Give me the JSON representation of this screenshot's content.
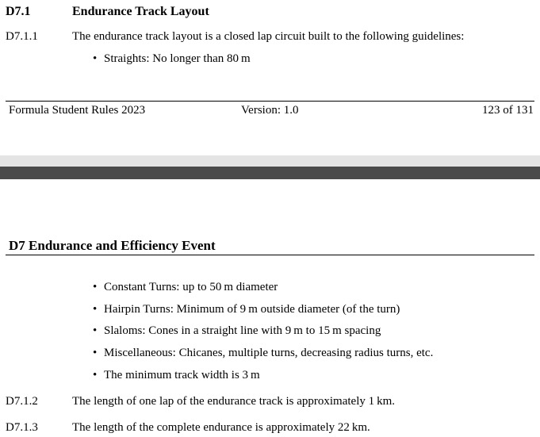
{
  "page1": {
    "section_number": "D7.1",
    "section_title": "Endurance Track Layout",
    "rule_number": "D7.1.1",
    "rule_text": "The endurance track layout is a closed lap circuit built to the following guidelines:",
    "bullets": [
      "Straights: No longer than 80 m"
    ],
    "footer": {
      "left": "Formula Student Rules 2023",
      "center": "Version: 1.0",
      "right": "123 of 131"
    }
  },
  "page2": {
    "header": "D7  Endurance and Efficiency Event",
    "bullets": [
      "Constant Turns: up to 50 m diameter",
      "Hairpin Turns: Minimum of 9 m outside diameter (of the turn)",
      "Slaloms: Cones in a straight line with 9 m to 15 m spacing",
      "Miscellaneous: Chicanes, multiple turns, decreasing radius turns, etc.",
      "The minimum track width is 3 m"
    ],
    "rules": [
      {
        "number": "D7.1.2",
        "text": "The length of one lap of the endurance track is approximately 1 km."
      },
      {
        "number": "D7.1.3",
        "text": "The length of the complete endurance is approximately 22 km."
      }
    ]
  }
}
